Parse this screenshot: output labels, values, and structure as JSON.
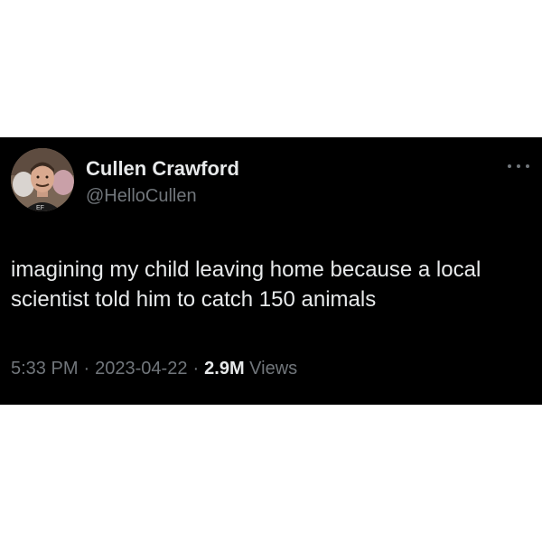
{
  "tweet": {
    "author": {
      "name": "Cullen Crawford",
      "handle": "@HelloCullen",
      "avatar_icon": "profile-photo"
    },
    "text": "imagining my child leaving home because a local scientist told him to catch 150 animals",
    "time": "5:33 PM",
    "date": "2023-04-22",
    "separator": "·",
    "views_count": "2.9M",
    "views_label": "Views",
    "more_icon": "more-options-icon"
  },
  "colors": {
    "card_background": "#000000",
    "primary_text": "#e7e9ea",
    "secondary_text": "#71767b"
  }
}
